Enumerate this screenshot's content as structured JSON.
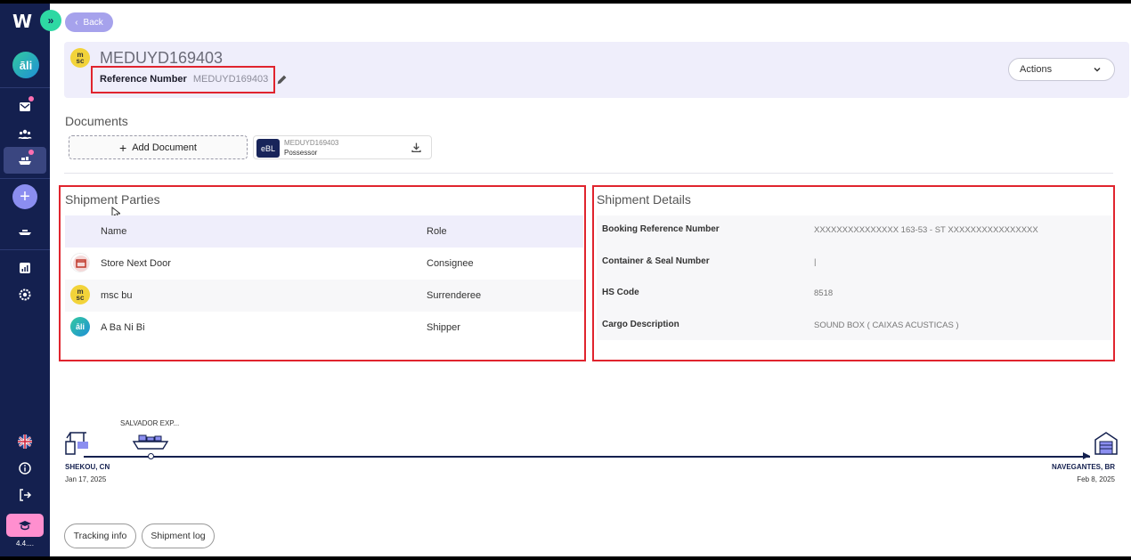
{
  "app": {
    "logo": "W",
    "version": "4.4...."
  },
  "back_label": "Back",
  "shipment": {
    "id": "MEDUYD169403",
    "carrier_logo": "msc",
    "reference_label": "Reference Number",
    "reference_value": "MEDUYD169403"
  },
  "actions_label": "Actions",
  "documents": {
    "title": "Documents",
    "add_label": "Add Document",
    "items": [
      {
        "badge": "eBL",
        "name": "MEDUYD169403",
        "role": "Possessor"
      }
    ]
  },
  "parties": {
    "title": "Shipment Parties",
    "headers": {
      "name": "Name",
      "role": "Role"
    },
    "rows": [
      {
        "name": "Store Next Door",
        "role": "Consignee"
      },
      {
        "name": "msc bu",
        "role": "Surrenderee"
      },
      {
        "name": "A Ba Ni Bi",
        "role": "Shipper"
      }
    ]
  },
  "details": {
    "title": "Shipment Details",
    "rows": [
      {
        "label": "Booking Reference Number",
        "value": "XXXXXXXXXXXXXXX 163-53 - ST XXXXXXXXXXXXXXXX"
      },
      {
        "label": "Container & Seal Number",
        "value": "|"
      },
      {
        "label": "HS Code",
        "value": "8518"
      },
      {
        "label": "Cargo Description",
        "value": "SOUND BOX ( CAIXAS ACUSTICAS )"
      }
    ]
  },
  "route": {
    "vessel": "SALVADOR EXP...",
    "origin": {
      "port": "SHEKOU, CN",
      "date": "Jan 17, 2025"
    },
    "destination": {
      "port": "NAVEGANTES, BR",
      "date": "Feb 8, 2025"
    }
  },
  "footer": {
    "tracking_label": "Tracking info",
    "log_label": "Shipment log"
  },
  "colors": {
    "sidebar": "#14204f",
    "accent": "#a6a2ec",
    "highlight": "#e0242e",
    "header_bg": "#efeefb"
  }
}
